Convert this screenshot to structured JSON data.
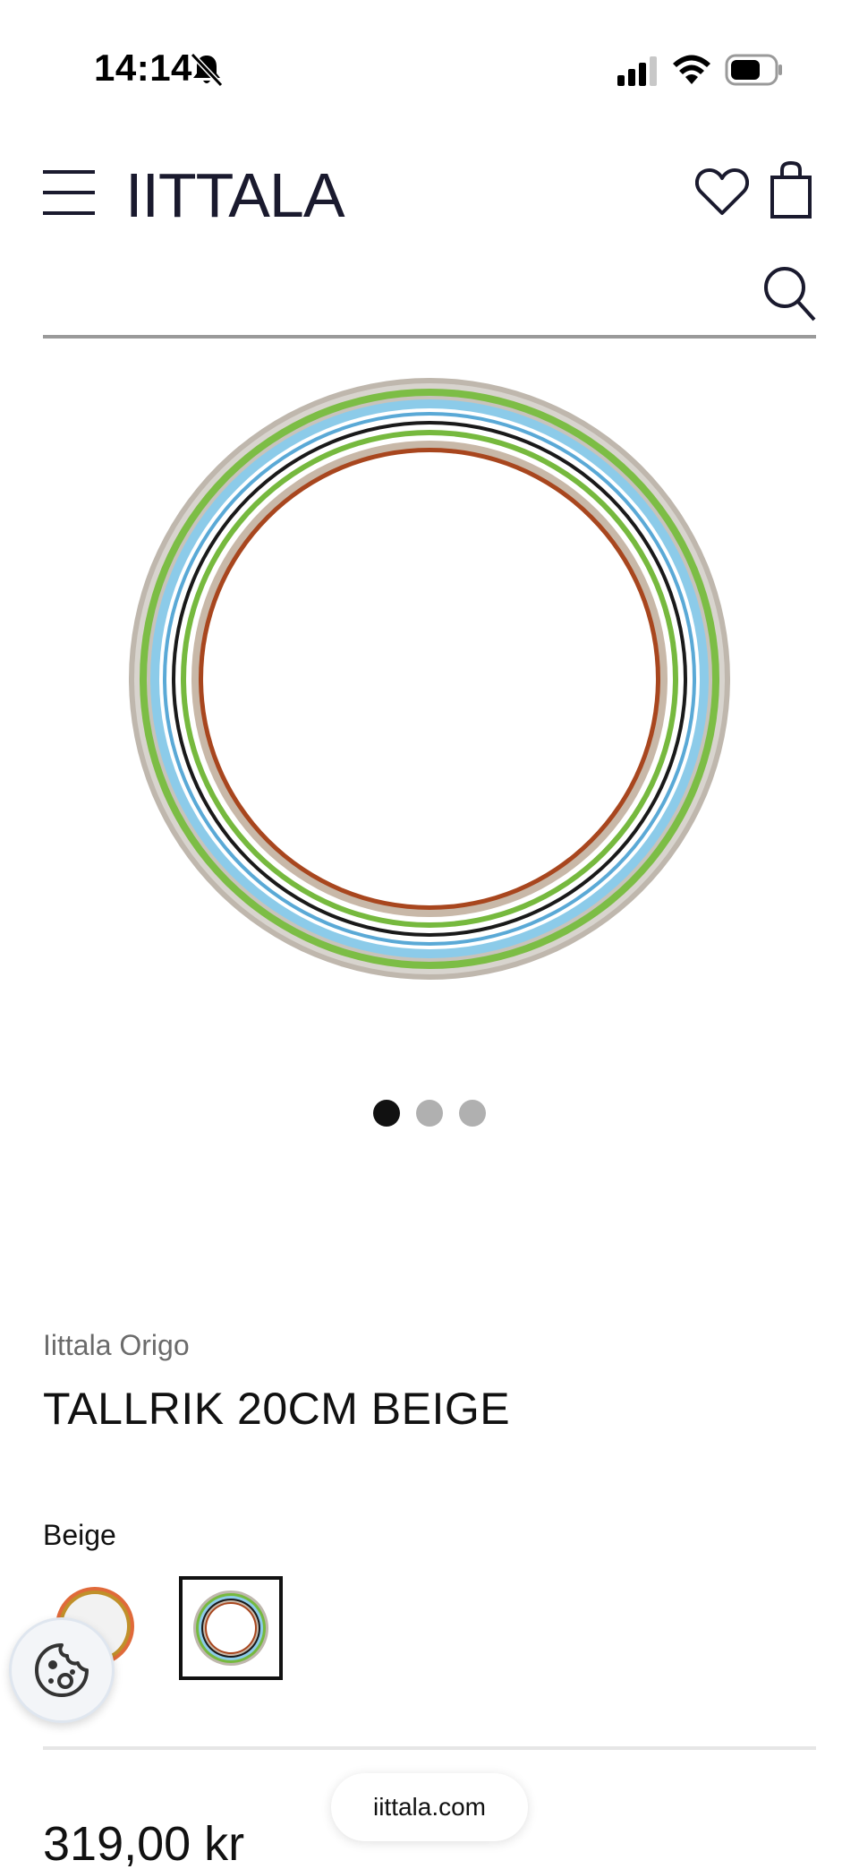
{
  "status_bar": {
    "time": "14:14",
    "icons": [
      "bell-slash-icon",
      "cellular-signal-icon",
      "wifi-icon",
      "battery-icon"
    ]
  },
  "header": {
    "logo": "IITTALA",
    "icons": [
      "menu-icon",
      "heart-icon",
      "shopping-bag-icon"
    ]
  },
  "search": {
    "value": "",
    "placeholder": "",
    "icon": "search-icon"
  },
  "gallery": {
    "image": "product-plate-image",
    "slides": 3,
    "active_slide": 1
  },
  "product": {
    "brand": "Iittala Origo",
    "title": "TALLRIK 20CM BEIGE",
    "variant_label": "Beige",
    "swatches": [
      "swatch-orange",
      "swatch-beige"
    ],
    "selected_swatch": 2,
    "price": "319,00 kr"
  },
  "cookie": {
    "icon": "cookie-icon"
  },
  "browser": {
    "url": "iittala.com"
  },
  "colors": {
    "text": "#111111",
    "logo": "#1a1a2e",
    "dot_inactive": "#b0b0b0",
    "plate_blue": "#8ccbe9",
    "plate_green": "#76b93e",
    "plate_brown": "#a8461e",
    "plate_beige": "#c8b8a8"
  }
}
